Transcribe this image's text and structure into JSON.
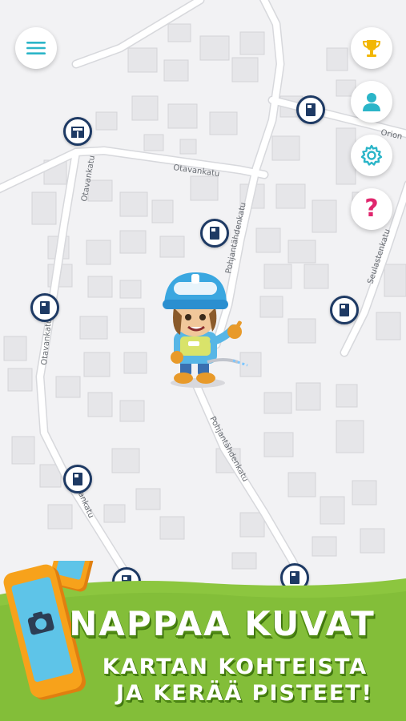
{
  "map": {
    "streets": {
      "otavankatu_top": "Otavankatu",
      "otavankatu_vertical_upper": "Otavankatu",
      "otavankatu_vertical_lower": "Otavankatu",
      "otavankatu_bottom": "Otavankatu",
      "pohjantahdenkatu_upper": "Pohjantähdenkatu",
      "pohjantahdenkatu_lower": "Pohjantähdenkatu",
      "orion": "Orion",
      "seulastenkatu": "Seulastenkatu"
    }
  },
  "controls": {
    "menu_icon": "hamburger-menu-icon",
    "trophy_icon": "trophy-icon",
    "profile_icon": "person-icon",
    "settings_icon": "gear-icon",
    "help_label": "?",
    "accent_color": "#2bb5c8",
    "trophy_color": "#f2b705",
    "help_color": "#e0266d"
  },
  "markers": {
    "icon": "building-icon",
    "border_color": "#1e3a64",
    "count": 8
  },
  "banner": {
    "title": "NAPPAA KUVAT",
    "line1": "KARTAN KOHTEISTA",
    "line2": "JA KERÄÄ PISTEET!",
    "grass_color": "#8cc63f",
    "phone_color": "#f7a21b"
  }
}
